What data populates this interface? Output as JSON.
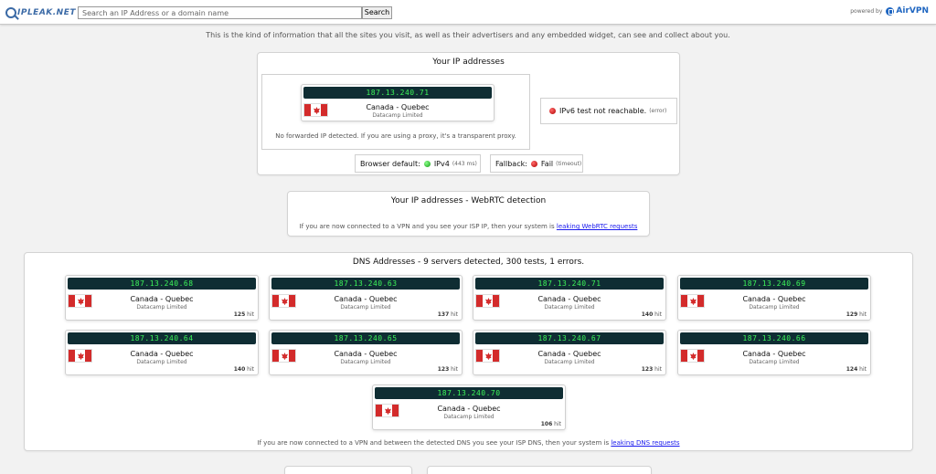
{
  "header": {
    "logo_text": "IPLEAK.NET",
    "search_placeholder": "Search an IP Address or a domain name",
    "search_button": "Search",
    "powered_label": "powered by",
    "airvpn_label": "AirVPN"
  },
  "intro": "This is the kind of information that all the sites you visit, as well as their advertisers and any embedded widget, can see and collect about you.",
  "ip_section": {
    "title": "Your IP addresses",
    "ipv4": {
      "ip": "187.13.240.71",
      "location": "Canada - Quebec",
      "isp": "Datacamp Limited"
    },
    "no_forward": "No forwarded IP detected. If you are using a proxy, it's a transparent proxy.",
    "ipv6_text": "IPv6 test not reachable.",
    "ipv6_note": "(error)",
    "browser_default_label": "Browser default:",
    "browser_default_value": "IPv4",
    "browser_default_note": "(443 ms)",
    "fallback_label": "Fallback:",
    "fallback_value": "Fail",
    "fallback_note": "(timeout)"
  },
  "webrtc": {
    "title": "Your IP addresses - WebRTC detection",
    "note": "If you are now connected to a VPN and you see your ISP IP, then your system is",
    "link": "leaking WebRTC requests"
  },
  "dns": {
    "title": "DNS Addresses - 9 servers detected, 300 tests, 1 errors.",
    "hit_suffix": "hit",
    "servers": [
      {
        "ip": "187.13.240.68",
        "location": "Canada - Quebec",
        "isp": "Datacamp Limited",
        "hits": "125"
      },
      {
        "ip": "187.13.240.63",
        "location": "Canada - Quebec",
        "isp": "Datacamp Limited",
        "hits": "137"
      },
      {
        "ip": "187.13.240.71",
        "location": "Canada - Quebec",
        "isp": "Datacamp Limited",
        "hits": "140"
      },
      {
        "ip": "187.13.240.69",
        "location": "Canada - Quebec",
        "isp": "Datacamp Limited",
        "hits": "129"
      },
      {
        "ip": "187.13.240.64",
        "location": "Canada - Quebec",
        "isp": "Datacamp Limited",
        "hits": "140"
      },
      {
        "ip": "187.13.240.65",
        "location": "Canada - Quebec",
        "isp": "Datacamp Limited",
        "hits": "123"
      },
      {
        "ip": "187.13.240.67",
        "location": "Canada - Quebec",
        "isp": "Datacamp Limited",
        "hits": "123"
      },
      {
        "ip": "187.13.240.66",
        "location": "Canada - Quebec",
        "isp": "Datacamp Limited",
        "hits": "124"
      },
      {
        "ip": "187.13.240.70",
        "location": "Canada - Quebec",
        "isp": "Datacamp Limited",
        "hits": "106"
      }
    ],
    "note": "If you are now connected to a VPN and between the detected DNS you see your ISP DNS, then your system is",
    "link": "leaking DNS requests"
  },
  "colors": {
    "ip_bar_bg": "#0f2d33",
    "ip_text": "#3df55a",
    "link": "#1a1aee",
    "brand": "#3b6aa6",
    "airvpn": "#1f66c1"
  }
}
